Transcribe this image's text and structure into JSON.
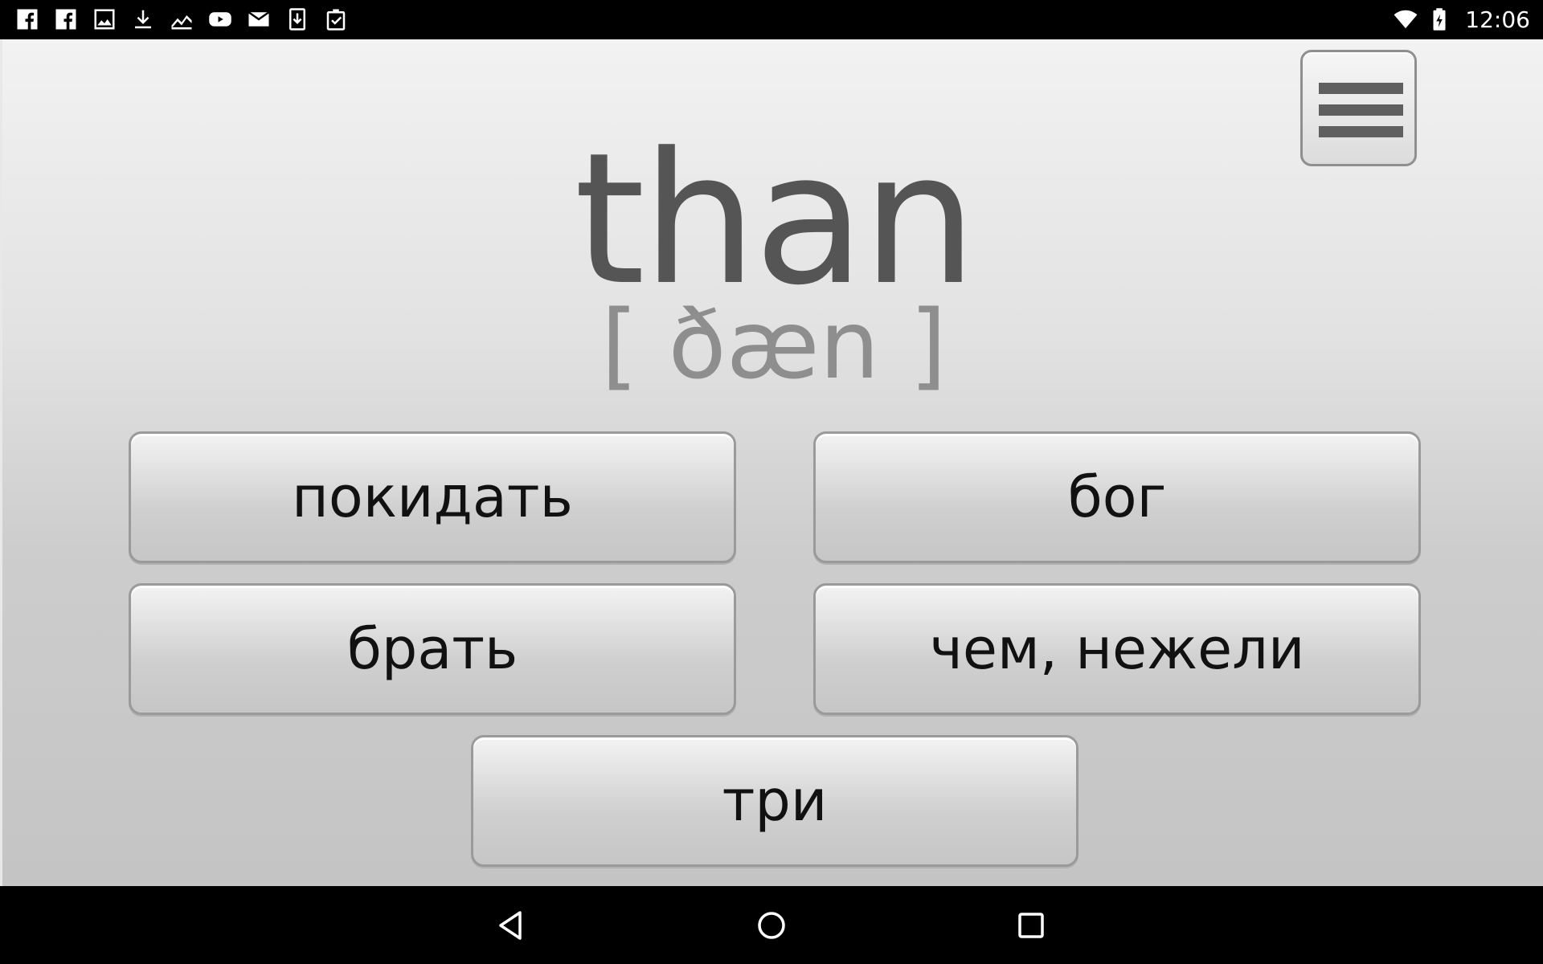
{
  "status_bar": {
    "time": "12:06",
    "left_icons": [
      "facebook-icon",
      "facebook-icon",
      "image-icon",
      "download-icon",
      "stock-chart-icon",
      "youtube-icon",
      "mail-icon",
      "download-file-icon",
      "clipboard-check-icon"
    ],
    "right_icons": [
      "wifi-icon",
      "battery-icon"
    ]
  },
  "quiz": {
    "word": "than",
    "transcription": "[ ðæn ]",
    "answers": [
      {
        "label": "покидать"
      },
      {
        "label": "бог"
      },
      {
        "label": "брать"
      },
      {
        "label": "чем, нежели"
      },
      {
        "label": "три"
      }
    ]
  },
  "menu": {
    "icon": "hamburger-menu-icon"
  },
  "navigation": {
    "buttons": [
      "back-icon",
      "home-icon",
      "recents-icon"
    ]
  },
  "colors": {
    "word": "#555555",
    "transcription": "#8e8e8e",
    "button_border": "#9a9a9a",
    "answer_text": "#111111"
  }
}
